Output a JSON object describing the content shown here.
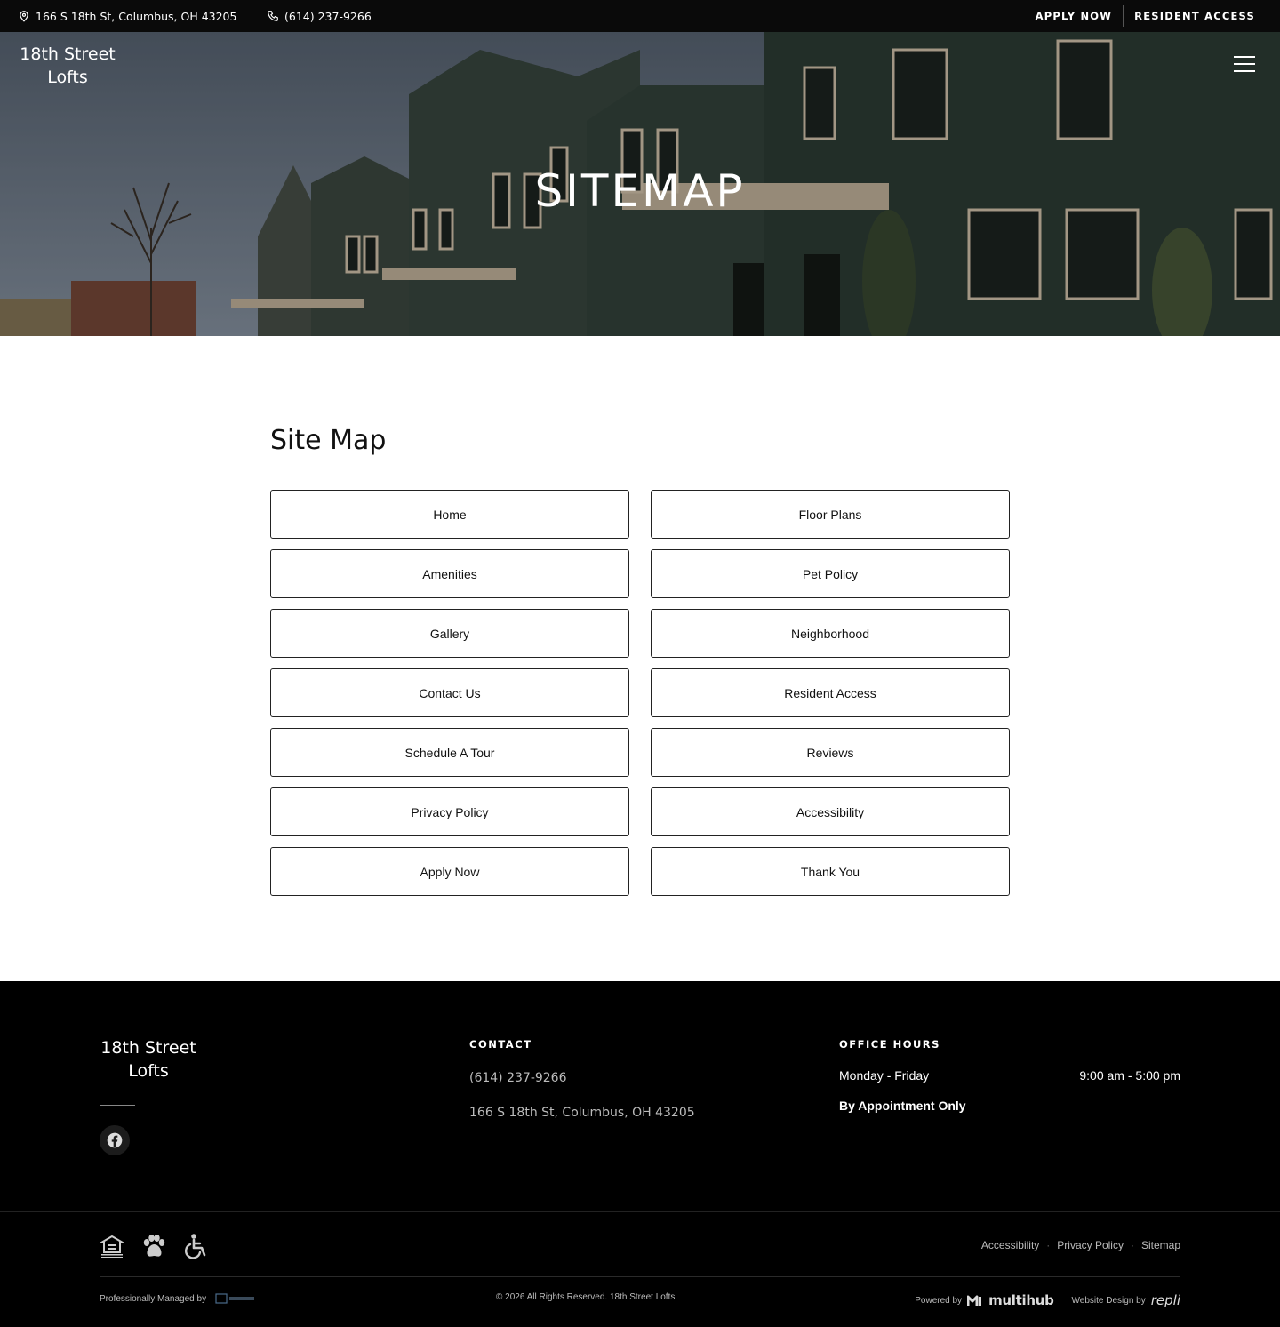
{
  "topbar": {
    "address": "166 S 18th St, Columbus, OH 43205",
    "phone": "(614) 237-9266",
    "apply_label": "APPLY NOW",
    "resident_label": "RESIDENT ACCESS"
  },
  "hero": {
    "logo_line1": "18th Street",
    "logo_line2": "Lofts",
    "title": "SITEMAP"
  },
  "main": {
    "title": "Site Map",
    "links": [
      "Home",
      "Floor Plans",
      "Amenities",
      "Pet Policy",
      "Gallery",
      "Neighborhood",
      "Contact Us",
      "Resident Access",
      "Schedule A Tour",
      "Reviews",
      "Privacy Policy",
      "Accessibility",
      "Apply Now",
      "Thank You"
    ]
  },
  "footer": {
    "logo_line1": "18th Street",
    "logo_line2": "Lofts",
    "contact_heading": "CONTACT",
    "phone": "(614) 237-9266",
    "address": "166 S 18th St, Columbus, OH 43205",
    "hours_heading": "OFFICE HOURS",
    "hours_days": "Monday - Friday",
    "hours_time": "9:00 am - 5:00 pm",
    "appointment": "By Appointment Only",
    "legal_links": [
      "Accessibility",
      "Privacy Policy",
      "Sitemap"
    ],
    "managed_label": "Professionally Managed by",
    "copyright": "© 2026 All Rights Reserved. 18th Street Lofts",
    "powered_label": "Powered by",
    "powered_brand": "multihub",
    "design_label": "Website Design by",
    "design_brand": "repli"
  },
  "icons": {
    "address": "map-pin-icon",
    "phone": "phone-icon",
    "menu": "hamburger-icon",
    "facebook": "facebook-icon",
    "housing": "equal-housing-icon",
    "pets": "paw-icon",
    "accessible": "wheelchair-icon"
  },
  "colors": {
    "topbar_bg": "#0a0a0a",
    "footer_bg": "#000000",
    "link_border": "#222222"
  }
}
